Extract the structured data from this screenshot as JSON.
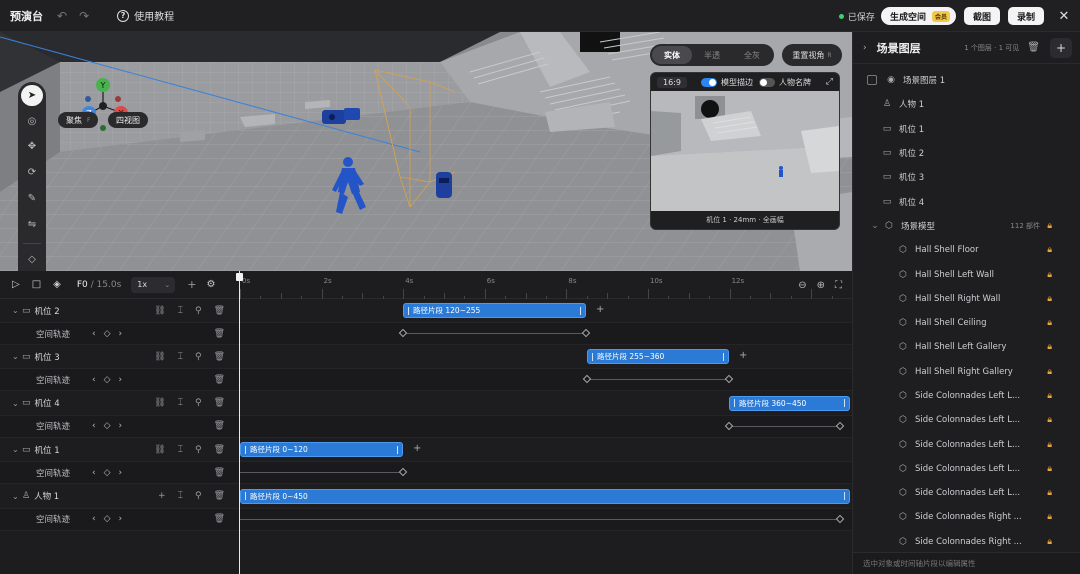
{
  "topbar": {
    "title": "预演台",
    "undo_icon": "↶",
    "redo_icon": "↷",
    "tutorial_label": "使用教程",
    "saved_label": "已保存",
    "generate_label": "生成空间",
    "generate_badge": "会员",
    "screenshot_label": "截图",
    "record_label": "录制",
    "close_icon": "✕"
  },
  "viewport": {
    "gizmo": {
      "y": "Y",
      "z": "Z",
      "x": "X"
    },
    "focus_label": "聚焦",
    "focus_key": "F",
    "quad_view_label": "四视图",
    "modes": [
      "实体",
      "半透",
      "全灰"
    ],
    "active_mode": "实体",
    "reset_view_label": "重置视角",
    "reset_view_key": "R",
    "preview": {
      "ratio": "16:9",
      "model_outline_label": "模型描边",
      "model_outline_on": true,
      "character_name_label": "人物名牌",
      "character_name_on": false,
      "footer": "机位 1 · 24mm · 全画幅"
    }
  },
  "timeline": {
    "current_frame": "F0",
    "total": "/ 15.0s",
    "speed": "1x",
    "ruler": [
      "0s",
      "2s",
      "4s",
      "6s",
      "8s",
      "10s",
      "12s"
    ],
    "tracks": [
      {
        "name": "机位 2",
        "sub": "空间轨迹",
        "clip": "路径片段 120~255"
      },
      {
        "name": "机位 3",
        "sub": "空间轨迹",
        "clip": "路径片段 255~360"
      },
      {
        "name": "机位 4",
        "sub": "空间轨迹",
        "clip": "路径片段 360~450"
      },
      {
        "name": "机位 1",
        "sub": "空间轨迹",
        "clip": "路径片段 0~120"
      },
      {
        "name": "人物 1",
        "sub": "空间轨迹",
        "clip": "路径片段 0~450"
      }
    ]
  },
  "layers": {
    "title": "场景图层",
    "meta": "1 个图层 · 1 可见",
    "items": [
      {
        "label": "场景图层 1",
        "icon": "eye",
        "indent": 0
      },
      {
        "label": "人物 1",
        "icon": "person",
        "indent": 1
      },
      {
        "label": "机位 1",
        "icon": "camera",
        "indent": 1
      },
      {
        "label": "机位 2",
        "icon": "camera",
        "indent": 1
      },
      {
        "label": "机位 3",
        "icon": "camera",
        "indent": 1
      },
      {
        "label": "机位 4",
        "icon": "camera",
        "indent": 1
      },
      {
        "label": "场景模型",
        "icon": "cube",
        "indent": 1,
        "count": "112 部件",
        "locked": true
      },
      {
        "label": "Hall Shell Floor",
        "icon": "cube",
        "indent": 2,
        "locked": true
      },
      {
        "label": "Hall Shell Left Wall",
        "icon": "cube",
        "indent": 2,
        "locked": true
      },
      {
        "label": "Hall Shell Right Wall",
        "icon": "cube",
        "indent": 2,
        "locked": true
      },
      {
        "label": "Hall Shell Ceiling",
        "icon": "cube",
        "indent": 2,
        "locked": true
      },
      {
        "label": "Hall Shell Left Gallery",
        "icon": "cube",
        "indent": 2,
        "locked": true
      },
      {
        "label": "Hall Shell Right Gallery",
        "icon": "cube",
        "indent": 2,
        "locked": true
      },
      {
        "label": "Side Colonnades Left L...",
        "icon": "cube",
        "indent": 2,
        "locked": true
      },
      {
        "label": "Side Colonnades Left L...",
        "icon": "cube",
        "indent": 2,
        "locked": true
      },
      {
        "label": "Side Colonnades Left L...",
        "icon": "cube",
        "indent": 2,
        "locked": true
      },
      {
        "label": "Side Colonnades Left L...",
        "icon": "cube",
        "indent": 2,
        "locked": true
      },
      {
        "label": "Side Colonnades Left L...",
        "icon": "cube",
        "indent": 2,
        "locked": true
      },
      {
        "label": "Side Colonnades Right ...",
        "icon": "cube",
        "indent": 2,
        "locked": true
      },
      {
        "label": "Side Colonnades Right ...",
        "icon": "cube",
        "indent": 2,
        "locked": true
      }
    ],
    "footer": "选中对象或时间轴片段以编辑属性"
  },
  "colors": {
    "accent": "#2b7bd6",
    "lock": "#e8a33b",
    "saved_dot": "#3ccf6e"
  }
}
